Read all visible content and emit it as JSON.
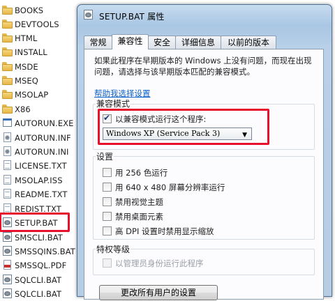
{
  "explorer": {
    "items": [
      {
        "name": "BOOKS",
        "icon": "folder-icon"
      },
      {
        "name": "DEVTOOLS",
        "icon": "folder-icon"
      },
      {
        "name": "HTML",
        "icon": "folder-icon"
      },
      {
        "name": "INSTALL",
        "icon": "folder-icon"
      },
      {
        "name": "MSDE",
        "icon": "folder-icon"
      },
      {
        "name": "MSEQ",
        "icon": "folder-icon"
      },
      {
        "name": "MSOLAP",
        "icon": "folder-icon"
      },
      {
        "name": "X86",
        "icon": "folder-icon"
      },
      {
        "name": "AUTORUN.EXE",
        "icon": "exe-icon"
      },
      {
        "name": "AUTORUN.INF",
        "icon": "gear-icon"
      },
      {
        "name": "AUTORUN.INI",
        "icon": "gear-icon"
      },
      {
        "name": "LICENSE.TXT",
        "icon": "doc-icon"
      },
      {
        "name": "MSOLAP.ISS",
        "icon": "doc-icon"
      },
      {
        "name": "README.TXT",
        "icon": "doc-icon"
      },
      {
        "name": "REDIST.TXT",
        "icon": "doc-icon"
      },
      {
        "name": "SETUP.BAT",
        "icon": "bat-icon"
      },
      {
        "name": "SMSCLI.BAT",
        "icon": "bat-icon"
      },
      {
        "name": "SMSSQINS.BAT",
        "icon": "bat-icon"
      },
      {
        "name": "SMSSQL.PDF",
        "icon": "pdf-icon"
      },
      {
        "name": "SQLCLI.BAT",
        "icon": "bat-icon"
      },
      {
        "name": "SQLCLI.BAT",
        "icon": "bat-icon"
      }
    ],
    "highlight_color": "#e8112d"
  },
  "dialog": {
    "title": "SETUP.BAT 属性",
    "tabs": [
      {
        "label": "常规"
      },
      {
        "label": "兼容性"
      },
      {
        "label": "安全"
      },
      {
        "label": "详细信息"
      },
      {
        "label": "以前的版本"
      }
    ],
    "active_tab": "兼容性",
    "description": "如果此程序在早期版本的 Windows 上没有问题，而现在出现问题，请选择与该早期版本匹配的兼容模式。",
    "help_link": "帮助我选择设置",
    "compat_group": {
      "title": "兼容模式",
      "checkbox_label": "以兼容模式运行这个程序:",
      "checkbox_checked": true,
      "select_value": "Windows XP (Service Pack 3)"
    },
    "settings_group": {
      "title": "设置",
      "options": [
        {
          "label": "用 256 色运行",
          "checked": false
        },
        {
          "label": "用 640 x 480 屏幕分辨率运行",
          "checked": false
        },
        {
          "label": "禁用视觉主题",
          "checked": false
        },
        {
          "label": "禁用桌面元素",
          "checked": false
        },
        {
          "label": "高 DPI 设置时禁用显示缩放",
          "checked": false
        }
      ]
    },
    "privilege_group": {
      "title": "特权等级",
      "checkbox_label": "以管理员身份运行此程序",
      "checked": false,
      "disabled": true
    },
    "button_all_users": "更改所有用户的设置"
  }
}
